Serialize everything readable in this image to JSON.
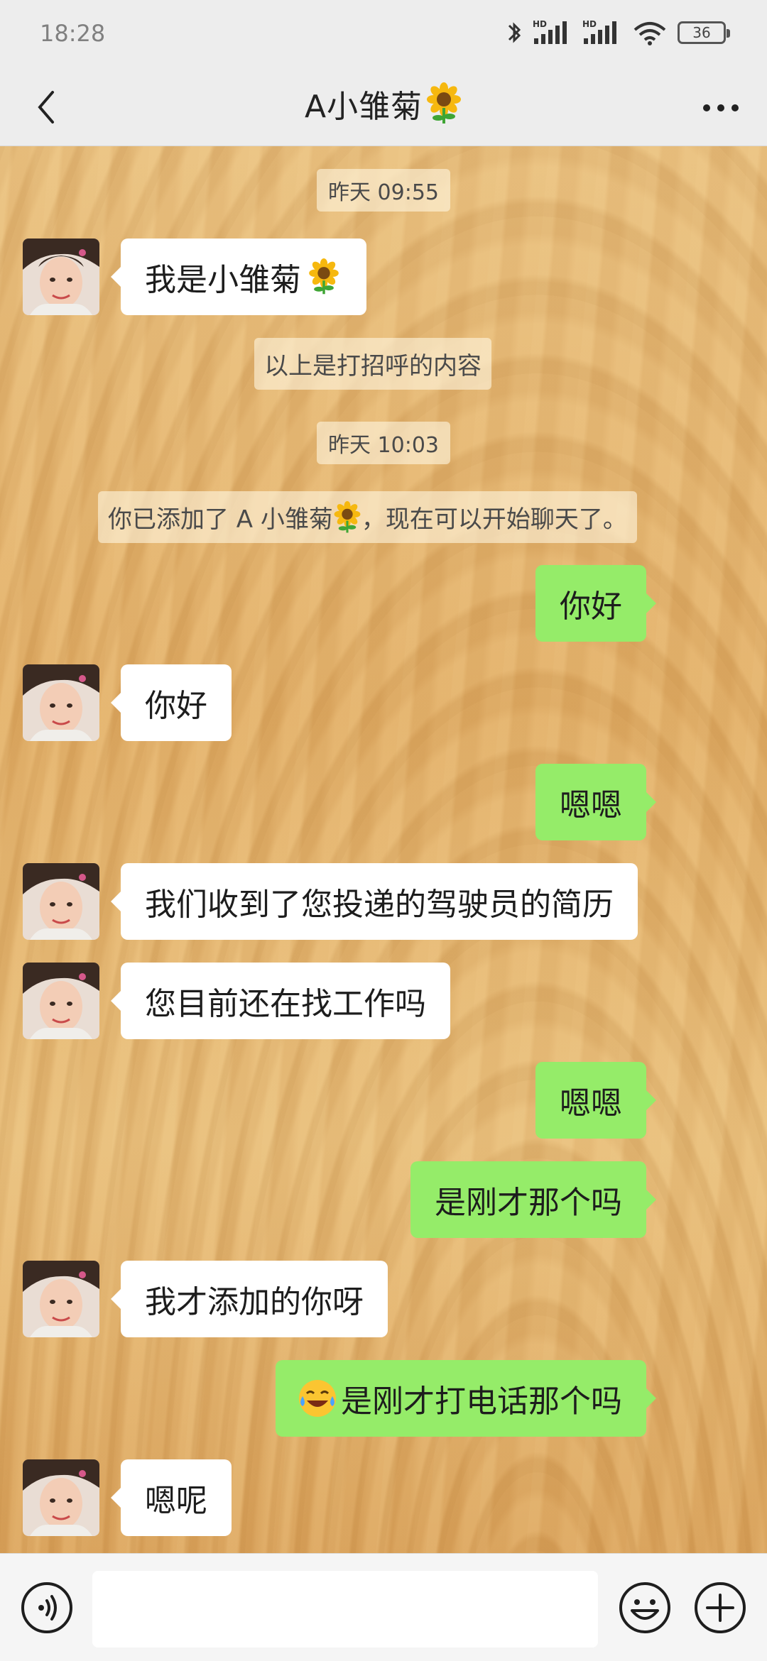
{
  "status_bar": {
    "time": "18:28",
    "battery": "36",
    "icons": [
      "bluetooth-icon",
      "hd-signal-icon",
      "hd-signal-icon",
      "wifi-icon",
      "battery-icon"
    ]
  },
  "header": {
    "title": "A小雏菊",
    "title_emoji": "sunflower-icon",
    "back_icon": "chevron-left-icon",
    "more_icon": "more-dots-icon"
  },
  "messages": {
    "t1": "昨天 09:55",
    "m1": "我是小雏菊",
    "sys1": "以上是打招呼的内容",
    "t2": "昨天 10:03",
    "sys2_prefix": "你已添加了 A 小雏菊",
    "sys2_suffix": "，现在可以开始聊天了。",
    "m2": "你好",
    "m3": "你好",
    "m4": "嗯嗯",
    "m5": "我们收到了您投递的驾驶员的简历",
    "m6": "您目前还在找工作吗",
    "m7": "嗯嗯",
    "m8": "是刚才那个吗",
    "m9": "我才添加的你呀",
    "m10": "是刚才打电话那个吗",
    "m11": "嗯呢"
  },
  "input_bar": {
    "voice_icon": "voice-icon",
    "emoji_icon": "emoji-icon",
    "plus_icon": "plus-icon",
    "text_value": ""
  },
  "colors": {
    "outgoing_bubble": "#95ec69",
    "incoming_bubble": "#ffffff",
    "chrome_bg": "#ededed"
  }
}
